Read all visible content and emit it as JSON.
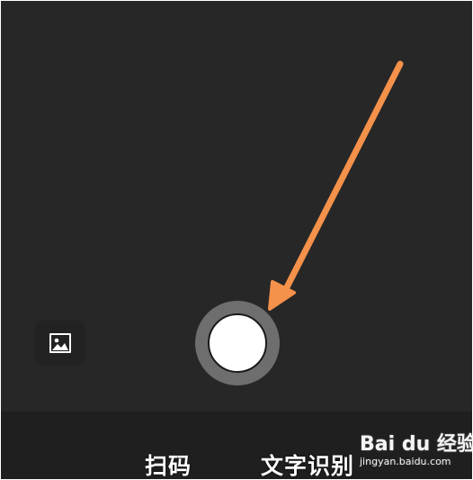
{
  "modes": {
    "scan_label": "扫码",
    "ocr_label": "文字识别"
  },
  "icons": {
    "gallery": "image-icon",
    "shutter": "shutter-button",
    "annotation": "arrow-icon"
  },
  "colors": {
    "background": "#272727",
    "bottom_bar": "#1f1f1f",
    "shutter_ring": "#6e6e6e",
    "shutter_inner": "#ffffff",
    "arrow": "#f4914a"
  },
  "watermark": {
    "logo": "Bai du 经验",
    "url": "jingyan.baidu.com"
  }
}
